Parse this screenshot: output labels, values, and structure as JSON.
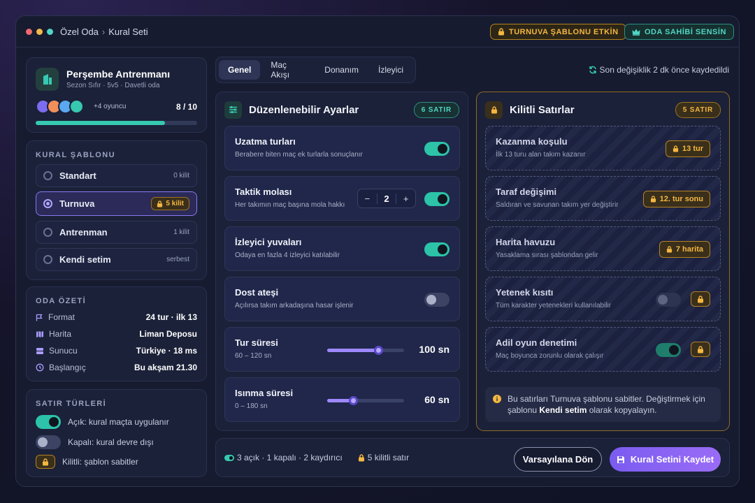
{
  "window": {
    "breadcrumb": {
      "room": "Özel Oda",
      "sep": "›",
      "page": "Kural Seti"
    },
    "badge_template": "TURNUVA ŞABLONU ETKİN",
    "badge_owner": "ODA SAHİBİ SENSİN"
  },
  "team": {
    "name": "Perşembe Antrenmanı",
    "meta": "Sezon Sıfır · 5v5 · Davetli oda",
    "extra_players": "+4 oyuncu",
    "count": "8 / 10",
    "fill_fraction": 0.8,
    "avatar_colors": [
      "#7b6cf0",
      "#f08f5a",
      "#5aa8f0",
      "#36c9b0"
    ]
  },
  "template": {
    "heading": "KURAL ŞABLONU",
    "options": [
      {
        "name": "Standart",
        "meta": "0 kilit",
        "selected": false
      },
      {
        "name": "Turnuva",
        "meta": "5 kilit",
        "selected": true
      },
      {
        "name": "Antrenman",
        "meta": "1 kilit",
        "selected": false
      },
      {
        "name": "Kendi setim",
        "meta": "serbest",
        "selected": false
      }
    ]
  },
  "summary": {
    "heading": "ODA ÖZETİ",
    "rows": [
      {
        "icon": "flag-icon",
        "key": "Format",
        "value": "24 tur · ilk 13"
      },
      {
        "icon": "map-icon",
        "key": "Harita",
        "value": "Liman Deposu"
      },
      {
        "icon": "server-icon",
        "key": "Sunucu",
        "value": "Türkiye · 18 ms"
      },
      {
        "icon": "clock-icon",
        "key": "Başlangıç",
        "value": "Bu akşam 21.30"
      }
    ]
  },
  "legend": {
    "heading": "SATIR TÜRLERİ",
    "on": "Açık: kural maçta uygulanır",
    "off": "Kapalı: kural devre dışı",
    "locked": "Kilitli: şablon sabitler"
  },
  "tabs": [
    "Genel",
    "Maç Akışı",
    "Donanım",
    "İzleyici"
  ],
  "saved_status": "Son değişiklik 2 dk önce kaydedildi",
  "editable": {
    "title": "Düzenlenebilir Ayarlar",
    "count": "6 SATIR",
    "rows": [
      {
        "title": "Uzatma turları",
        "sub": "Berabere biten maç ek turlarla sonuçlanır",
        "on": true
      },
      {
        "title": "Taktik molası",
        "sub": "Her takımın maç başına mola hakkı",
        "on": true,
        "stepper": "2"
      },
      {
        "title": "İzleyici yuvaları",
        "sub": "Odaya en fazla 4 izleyici katılabilir",
        "on": true
      },
      {
        "title": "Dost ateşi",
        "sub": "Açılırsa takım arkadaşına hasar işlenir",
        "on": false
      },
      {
        "title": "Tur süresi",
        "sub": "60 – 120 sn",
        "value": "100 sn",
        "min": 60,
        "max": 120,
        "current": 100
      },
      {
        "title": "Isınma süresi",
        "sub": "0 – 180 sn",
        "value": "60 sn",
        "min": 0,
        "max": 180,
        "current": 60
      }
    ]
  },
  "locked": {
    "title": "Kilitli Satırlar",
    "count": "5 SATIR",
    "rows": [
      {
        "title": "Kazanma koşulu",
        "sub": "İlk 13 turu alan takım kazanır",
        "value": "13 tur"
      },
      {
        "title": "Taraf değişimi",
        "sub": "Saldıran ve savunan takım yer değiştirir",
        "value": "12. tur sonu"
      },
      {
        "title": "Harita havuzu",
        "sub": "Yasaklama sırası şablondan gelir",
        "value": "7 harita"
      },
      {
        "title": "Yetenek kısıtı",
        "sub": "Tüm karakter yetenekleri kullanılabilir",
        "on": false
      },
      {
        "title": "Adil oyun denetimi",
        "sub": "Maç boyunca zorunlu olarak çalışır",
        "on": true
      }
    ],
    "note_part1": "Bu satırları Turnuva şablonu sabitler. Değiştirmek için şablonu ",
    "note_bold": "Kendi setim",
    "note_part2": " olarak kopyalayın."
  },
  "footer": {
    "stats": "3 açık · 1 kapalı · 2 kaydırıcı",
    "locked_stats": "5 kilitli satır",
    "reset": "Varsayılana Dön",
    "save": "Kural Setini Kaydet"
  },
  "colors": {
    "accent": "#8a6cf5",
    "teal": "#36c9b0",
    "amber": "#f4b740"
  }
}
